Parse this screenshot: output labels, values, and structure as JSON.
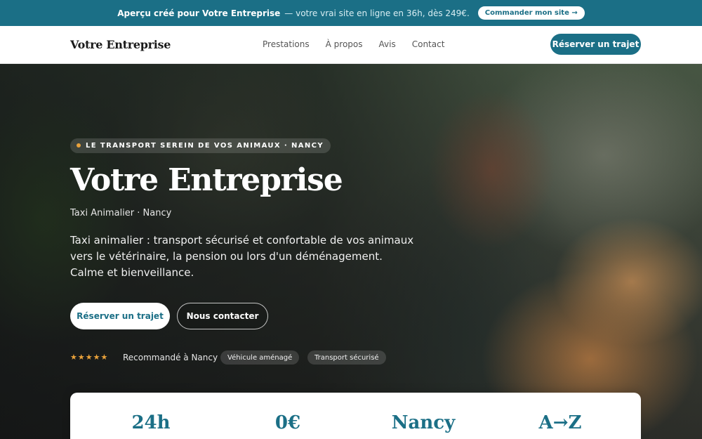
{
  "promo": {
    "bold_text": "Aperçu créé pour Votre Entreprise",
    "text": "— votre vrai site en ligne en 36h, dès 249€.",
    "cta_label": "Commander mon site →"
  },
  "header": {
    "brand": "Votre Entreprise",
    "nav": [
      "Prestations",
      "À propos",
      "Avis",
      "Contact"
    ],
    "cta_label": "Réserver un trajet"
  },
  "hero": {
    "kicker": "LE TRANSPORT SEREIN DE VOS ANIMAUX · NANCY",
    "title": "Votre Entreprise",
    "subtitle": "Taxi Animalier · Nancy",
    "description": "Taxi animalier : transport sécurisé et confortable de vos animaux vers le vétérinaire, la pension ou lors d'un déménagement. Calme et bienveillance.",
    "primary_button": "Réserver un trajet",
    "secondary_button": "Nous contacter",
    "rating_stars": "★★★★★",
    "recommendation": "Recommandé à Nancy",
    "tags": [
      "Véhicule aménagé",
      "Transport sécurisé"
    ]
  },
  "stats": [
    "24h",
    "0€",
    "Nancy",
    "A→Z"
  ],
  "colors": {
    "accent": "#1b6f86",
    "star": "#e9a23b",
    "white": "#ffffff"
  }
}
